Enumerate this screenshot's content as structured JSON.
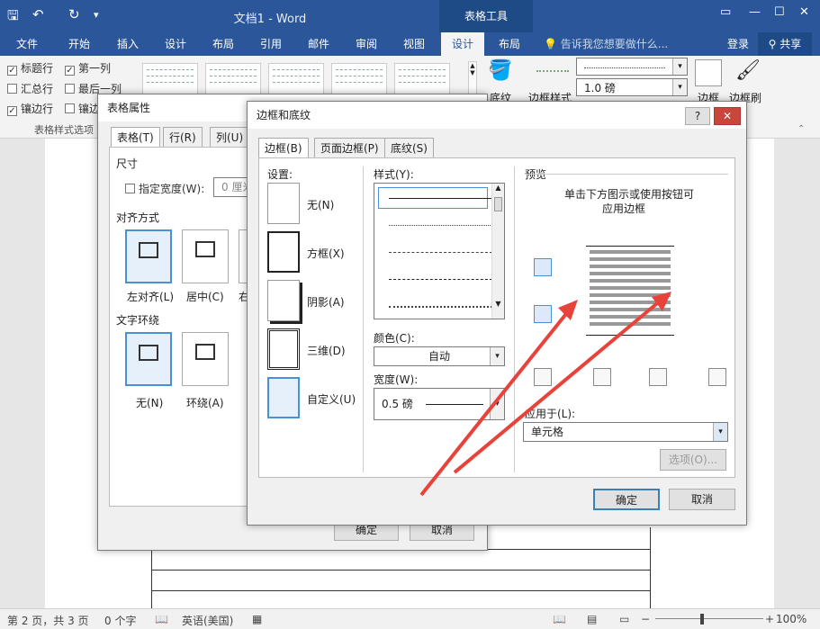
{
  "titlebar": {
    "doc_title": "文档1 - Word",
    "context_tab": "表格工具"
  },
  "ribbon_tabs": [
    {
      "label": "文件"
    },
    {
      "label": "开始"
    },
    {
      "label": "插入"
    },
    {
      "label": "设计"
    },
    {
      "label": "布局"
    },
    {
      "label": "引用"
    },
    {
      "label": "邮件"
    },
    {
      "label": "审阅"
    },
    {
      "label": "视图"
    },
    {
      "label": "设计"
    },
    {
      "label": "布局"
    }
  ],
  "tellme": "告诉我您想要做什么...",
  "account": {
    "login": "登录",
    "share": "共享"
  },
  "ribbon": {
    "options": [
      {
        "label": "标题行",
        "checked": "✓"
      },
      {
        "label": "第一列",
        "checked": "✓"
      },
      {
        "label": "汇总行",
        "checked": ""
      },
      {
        "label": "最后一列",
        "checked": ""
      },
      {
        "label": "镶边行",
        "checked": "✓"
      },
      {
        "label": "镶边列",
        "checked": ""
      }
    ],
    "group_label": "表格样式选项",
    "shading_label": "底纹",
    "border_style_label": "边框样式",
    "pen_weight": "1.0 磅",
    "borders_label": "边框",
    "border_painter_label": "边框刷"
  },
  "table_props": {
    "title": "表格属性",
    "tabs": [
      "表格(T)",
      "行(R)",
      "列(U)"
    ],
    "size_label": "尺寸",
    "preferred_width": "指定宽度(W):",
    "width_value": "0 厘米",
    "alignment_label": "对齐方式",
    "align_left": "左对齐(L)",
    "align_center": "居中(C)",
    "align_right": "右",
    "wrap_label": "文字环绕",
    "wrap_none": "无(N)",
    "wrap_around": "环绕(A)",
    "ok": "确定",
    "cancel": "取消"
  },
  "borders_dialog": {
    "title": "边框和底纹",
    "help": "?",
    "close": "✕",
    "tabs": [
      "边框(B)",
      "页面边框(P)",
      "底纹(S)"
    ],
    "setting_label": "设置:",
    "settings": [
      "无(N)",
      "方框(X)",
      "阴影(A)",
      "三维(D)",
      "自定义(U)"
    ],
    "style_label": "样式(Y):",
    "color_label": "颜色(C):",
    "color_value": "自动",
    "width_label": "宽度(W):",
    "width_value": "0.5 磅",
    "preview_label": "预览",
    "preview_hint_1": "单击下方图示或使用按钮可",
    "preview_hint_2": "应用边框",
    "apply_label": "应用于(L):",
    "apply_value": "单元格",
    "options_button": "选项(O)...",
    "ok": "确定",
    "cancel": "取消"
  },
  "statusbar": {
    "page": "第 2 页，共 3 页",
    "words": "0 个字",
    "language": "英语(美国)",
    "zoom": "100%"
  },
  "colors": {
    "word_blue": "#2b579a",
    "arrow_red": "#e8433a"
  }
}
